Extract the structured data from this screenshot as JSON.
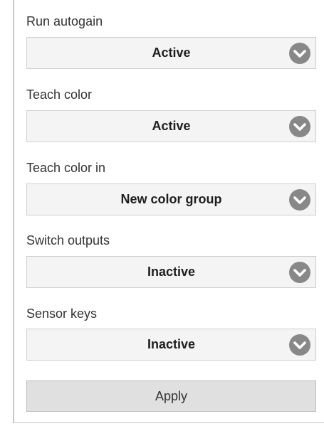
{
  "fields": [
    {
      "label": "Run autogain",
      "value": "Active"
    },
    {
      "label": "Teach color",
      "value": "Active"
    },
    {
      "label": "Teach color in",
      "value": "New color group"
    },
    {
      "label": "Switch outputs",
      "value": "Inactive"
    },
    {
      "label": "Sensor keys",
      "value": "Inactive"
    }
  ],
  "apply_label": "Apply",
  "icons": {
    "dropdown": "chevron-down-icon"
  },
  "colors": {
    "icon_circle": "#888888",
    "field_bg": "#f4f4f4",
    "button_bg": "#e0e0e0"
  }
}
